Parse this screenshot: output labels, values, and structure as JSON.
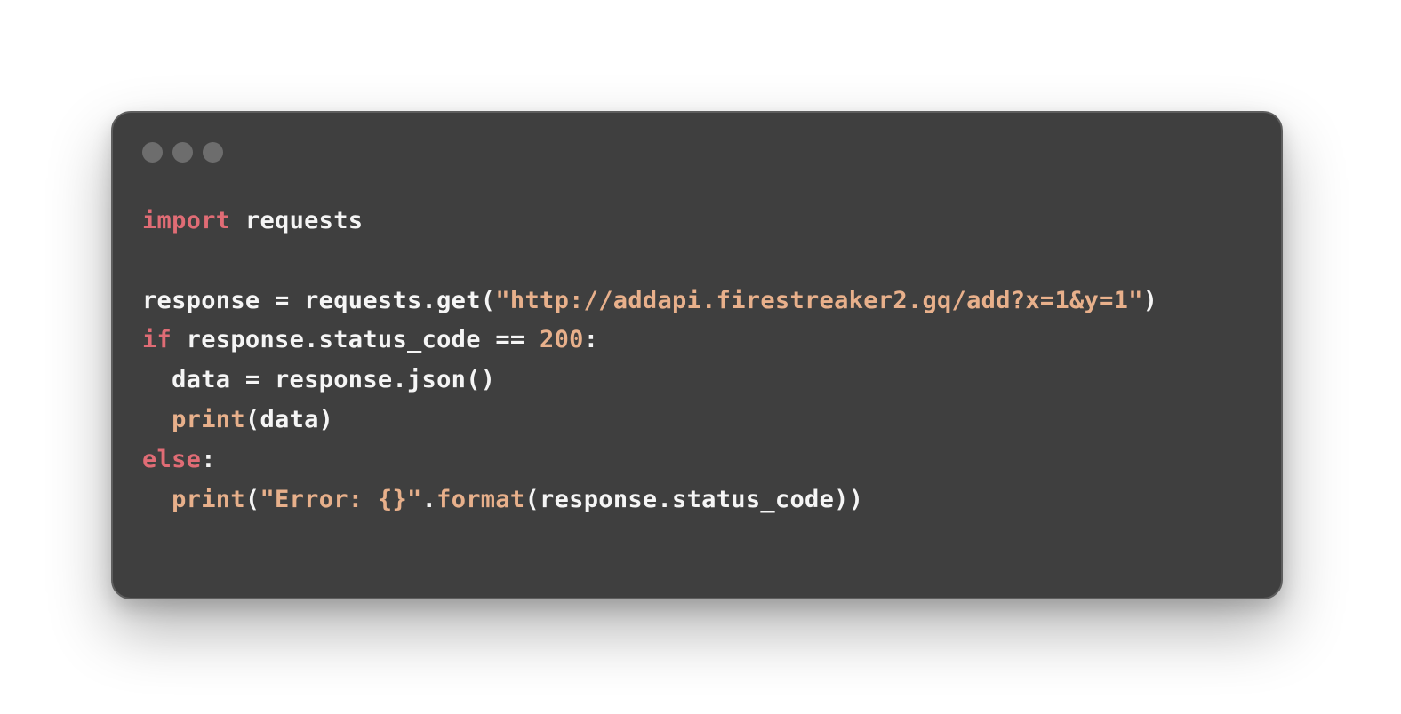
{
  "window": {
    "traffic_lights": [
      "dot",
      "dot",
      "dot"
    ]
  },
  "code": {
    "line1": {
      "kw": "import",
      "rest": " requests"
    },
    "line2": "",
    "line3": {
      "a": "response = requests.get(",
      "str": "\"http://addapi.firestreaker2.gq/add?x=1&y=1\"",
      "b": ")"
    },
    "line4": {
      "kw": "if",
      "a": " response.status_code == ",
      "num": "200",
      "b": ":"
    },
    "line5": "  data = response.json()",
    "line6": {
      "indent": "  ",
      "fn": "print",
      "rest": "(data)"
    },
    "line7": {
      "kw": "else",
      "rest": ":"
    },
    "line8": {
      "indent": "  ",
      "fn": "print",
      "a": "(",
      "str": "\"Error: {}\"",
      "b": ".",
      "fn2": "format",
      "c": "(response.status_code))"
    }
  },
  "colors": {
    "keyword": "#e06c75",
    "string": "#e8b08b",
    "text": "#f5f5f5",
    "window_bg": "#3f3f3f"
  }
}
